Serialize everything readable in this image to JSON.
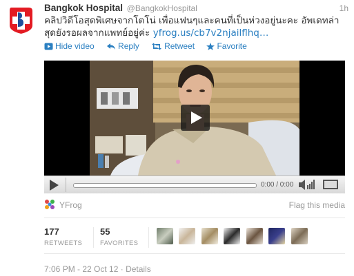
{
  "tweet": {
    "fullname": "Bangkok Hospital",
    "handle": "@BangkokHospital",
    "time": "1h",
    "text_line1": "คลิปวิดีโอสุดพิเศษจากโตโน่ เพื่อแฟนๆและคนที่เป็นห่วงอยู่นะคะ อัพเดทล่า",
    "text_line2_prefix": "สุดยังรอผลจากแพทย์อยู่ค่ะ ",
    "link_text": "yfrog.us/cb7v2njailflhq…"
  },
  "actions": {
    "hide_video": "Hide video",
    "reply": "Reply",
    "retweet": "Retweet",
    "favorite": "Favorite"
  },
  "player": {
    "timecode": "0:00 / 0:00",
    "progress": 0
  },
  "media": {
    "source": "YFrog",
    "flag": "Flag this media"
  },
  "stats": {
    "retweets_count": "177",
    "retweets_label": "RETWEETS",
    "favorites_count": "55",
    "favorites_label": "FAVORITES"
  },
  "footer": {
    "timestamp": "7:06 PM - 22 Oct 12",
    "separator": " · ",
    "details": "Details"
  },
  "colors": {
    "link": "#2a7fc1",
    "brand_red": "#e31b23",
    "muted": "#999999"
  },
  "icons": {
    "avatar": "bangkok-hospital-logo",
    "hide_video": "video-icon",
    "reply": "reply-arrow-icon",
    "retweet": "retweet-icon",
    "favorite": "star-icon",
    "media_source": "yfrog-logo"
  }
}
